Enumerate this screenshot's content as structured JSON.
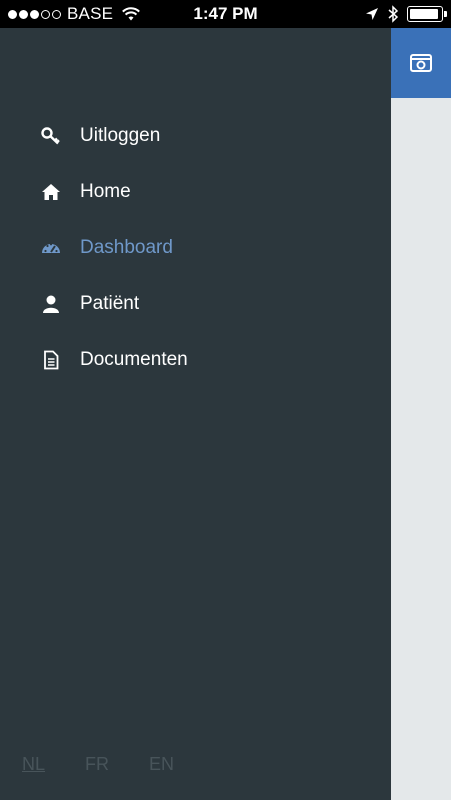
{
  "status_bar": {
    "carrier": "BASE",
    "time": "1:47 PM",
    "signal_icon": "signal-dots-icon",
    "wifi_icon": "wifi-icon",
    "location_icon": "location-arrow-icon",
    "bluetooth_icon": "bluetooth-icon",
    "battery_level": 0.95
  },
  "menu": {
    "items": [
      {
        "label": "Uitloggen",
        "icon": "key-icon"
      },
      {
        "label": "Home",
        "icon": "home-icon"
      },
      {
        "label": "Dashboard",
        "icon": "dashboard-gauge-icon",
        "active": true
      },
      {
        "label": "Patiënt",
        "icon": "user-icon"
      },
      {
        "label": "Documenten",
        "icon": "document-icon"
      }
    ]
  },
  "languages": {
    "nl": "NL",
    "fr": "FR",
    "en": "EN",
    "selected": "NL"
  },
  "content_header": {
    "icon": "photo-card-icon",
    "color": "#3a71b8"
  },
  "colors": {
    "drawer_bg": "#2c373d",
    "active": "#6f98c9",
    "content_bg": "#e4e8ea"
  }
}
